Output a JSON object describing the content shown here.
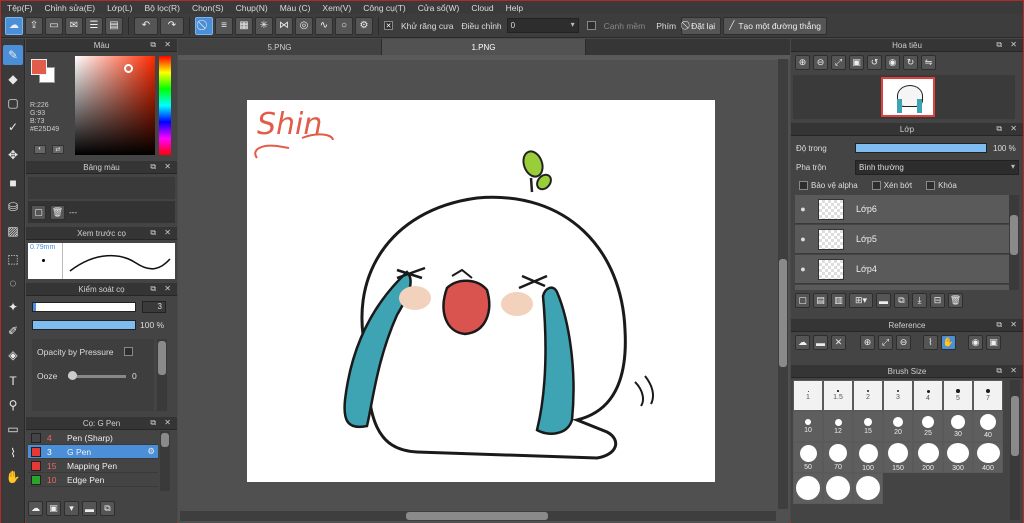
{
  "menu": [
    "Tệp(F)",
    "Chỉnh sửa(E)",
    "Lớp(L)",
    "Bộ lọc(R)",
    "Chọn(S)",
    "Chụp(N)",
    "Màu (C)",
    "Xem(V)",
    "Công cụ(T)",
    "Cửa sổ(W)",
    "Cloud",
    "Help"
  ],
  "toolbar": {
    "antialias_label": "Khử răng cưa",
    "adjust_label": "Điều chỉnh",
    "adjust_value": "0",
    "smooth_edge_label": "Cạnh mềm",
    "key_label": "Phím",
    "reset_label": "Đặt lại",
    "make_line_label": "Tạo một đường thẳng"
  },
  "color_panel": {
    "title": "Màu",
    "r": "R:226",
    "g": "G:93",
    "b": "B:73",
    "hex": "#E25D49",
    "main_color": "#E25D49"
  },
  "palette_panel": {
    "title": "Bảng màu",
    "value": "---"
  },
  "brush_preview": {
    "title": "Xem trước cọ",
    "size_label": "0.79mm"
  },
  "brush_control": {
    "title": "Kiểm soát cọ",
    "size_value": "3",
    "opacity_value": "100 %",
    "opacity_pressure_label": "Opacity by Pressure",
    "ooze_label": "Ooze",
    "ooze_value": "0"
  },
  "brush_list": {
    "title": "Cọ: G Pen",
    "items": [
      {
        "num": "4",
        "name": "Pen (Sharp)",
        "color": "#444444"
      },
      {
        "num": "3",
        "name": "G Pen",
        "color": "#e53935"
      },
      {
        "num": "15",
        "name": "Mapping Pen",
        "color": "#e53935"
      },
      {
        "num": "10",
        "name": "Edge Pen",
        "color": "#2aa52a"
      }
    ]
  },
  "tabs": [
    "5.PNG",
    "1.PNG"
  ],
  "canvas": {
    "handwriting": "Shin"
  },
  "navigator": {
    "title": "Hoa tiêu"
  },
  "layer_panel": {
    "title": "Lớp",
    "opacity_label": "Độ trong",
    "opacity_value": "100 %",
    "blend_label": "Pha trộn",
    "blend_value": "Bình thường",
    "protect_alpha": "Bảo vệ alpha",
    "clipping": "Xén bớt",
    "lock": "Khóa",
    "layers": [
      "Lớp6",
      "Lớp5",
      "Lớp4"
    ]
  },
  "reference_panel": {
    "title": "Reference"
  },
  "brush_size_panel": {
    "title": "Brush Size",
    "sizes": [
      "1",
      "1.5",
      "2",
      "3",
      "4",
      "5",
      "7",
      "10",
      "12",
      "15",
      "20",
      "25",
      "30",
      "40",
      "50",
      "70",
      "100",
      "150",
      "200",
      "300",
      "400",
      "",
      "",
      ""
    ]
  }
}
